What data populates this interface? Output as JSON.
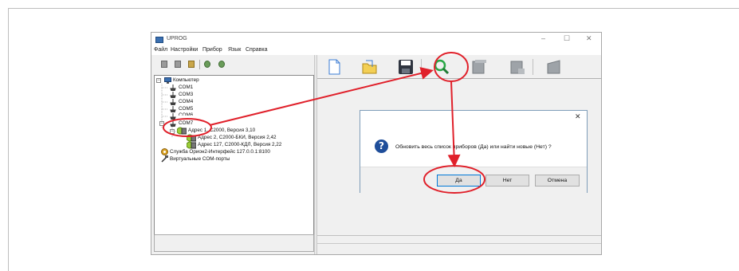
{
  "window": {
    "title": "UPROG",
    "controls": {
      "minimize": "–",
      "maximize": "☐",
      "close": "✕"
    }
  },
  "menu": [
    "Файл",
    "Настройки",
    "Прибор",
    "Язык",
    "Справка"
  ],
  "tree": {
    "root": "Компьютер",
    "ports": [
      "COM1",
      "COM3",
      "COM4",
      "COM5",
      "COM6",
      "COM7"
    ],
    "devices": [
      "Адрес 1, С2000, Версия 3,10",
      "Адрес 2, С2000-БКИ, Версия 2,42",
      "Адрес 127, С2000-КДЛ, Версия 2,22"
    ],
    "service": "Служба Орион2-Интерфейс 127.0.0.1:8100",
    "virtual": "Виртуальные COM-порты"
  },
  "dialog": {
    "close": "✕",
    "icon": "question-icon",
    "message": "Обновить весь список приборов (Да) или найти новые (Нет) ?",
    "buttons": {
      "yes": "Да",
      "no": "Нет",
      "cancel": "Отмена"
    }
  },
  "annotation_color": "#e0202a"
}
